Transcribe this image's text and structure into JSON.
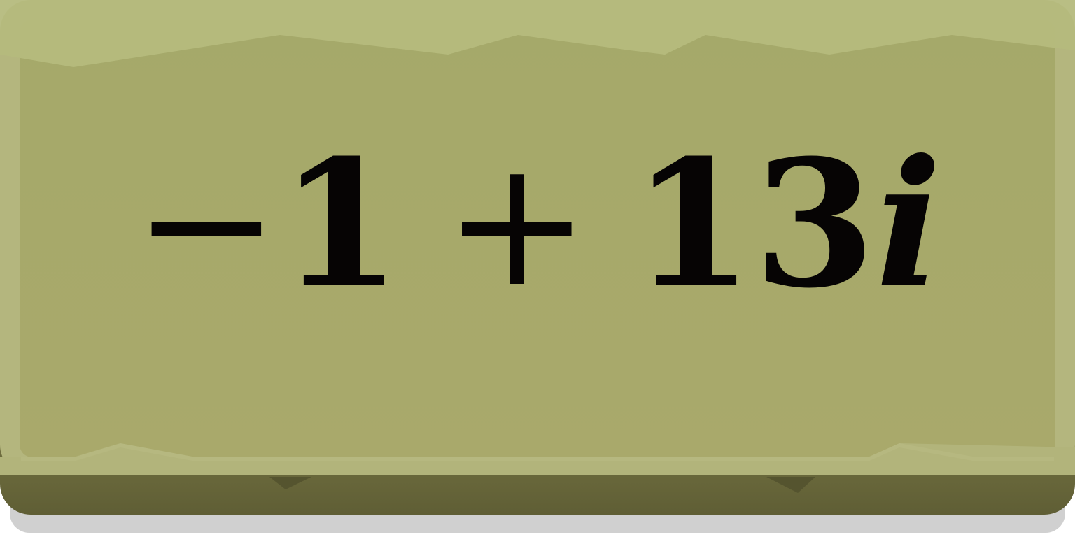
{
  "tile": {
    "colors": {
      "face": "#a7a96b",
      "face_top": "#b4ba7c",
      "rim": "#b5b77f",
      "edge_dark": "#6e6d3e",
      "shadow": "#cfcfcf"
    },
    "expression": {
      "sign": "−",
      "real": "1",
      "operator": "+",
      "imag": "13",
      "unit": "i"
    }
  }
}
